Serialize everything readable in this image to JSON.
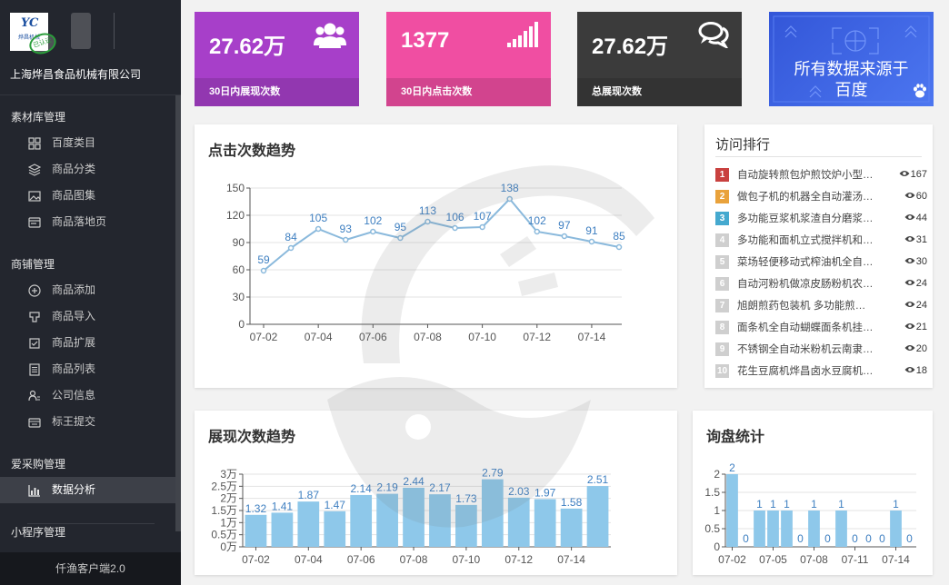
{
  "sidebar": {
    "logo_text": "YC",
    "logo_sub": "烨昌机械",
    "stamp_text": "已认证",
    "company": "上海烨昌食品机械有限公司",
    "groups": [
      {
        "title": "素材库管理",
        "items": [
          {
            "label": "百度类目",
            "icon": "grid-icon"
          },
          {
            "label": "商品分类",
            "icon": "layers-icon"
          },
          {
            "label": "商品图集",
            "icon": "image-icon"
          },
          {
            "label": "商品落地页",
            "icon": "browser-icon"
          }
        ]
      },
      {
        "title": "商铺管理",
        "items": [
          {
            "label": "商品添加",
            "icon": "plus-circle-icon"
          },
          {
            "label": "商品导入",
            "icon": "import-icon"
          },
          {
            "label": "商品扩展",
            "icon": "checklist-icon"
          },
          {
            "label": "商品列表",
            "icon": "list-icon"
          },
          {
            "label": "公司信息",
            "icon": "user-info-icon"
          },
          {
            "label": "标王提交",
            "icon": "store-icon"
          }
        ]
      },
      {
        "title": "爱采购管理",
        "items": [
          {
            "label": "数据分析",
            "icon": "bar-chart-icon",
            "active": true
          }
        ]
      },
      {
        "title": "小程序管理",
        "items": []
      }
    ],
    "footer": "仟渔客户端2.0"
  },
  "stats": [
    {
      "value": "27.62万",
      "label": "30日内展现次数",
      "icon": "users-icon",
      "color": "#a73fc9"
    },
    {
      "value": "1377",
      "label": "30日内点击次数",
      "icon": "signal-icon",
      "color": "#f04ea2"
    },
    {
      "value": "27.62万",
      "label": "总展现次数",
      "icon": "chat-icon",
      "color": "#3b3b3b"
    }
  ],
  "source_banner": {
    "line1": "所有数据来源于",
    "line2": "百度",
    "icon": "baidu-paw-icon"
  },
  "click_panel": {
    "title": "点击次数趋势"
  },
  "show_panel": {
    "title": "展现次数趋势"
  },
  "inquiry_panel": {
    "title": "询盘统计"
  },
  "rank_panel": {
    "title": "访问排行",
    "items": [
      {
        "no": "1",
        "name": "自动旋转煎包炉煎饺炉小型…",
        "views": "167",
        "color": "#c9413f"
      },
      {
        "no": "2",
        "name": "做包子机的机器全自动灌汤…",
        "views": "60",
        "color": "#e9a23b"
      },
      {
        "no": "3",
        "name": "多功能豆浆机浆渣自分磨浆…",
        "views": "44",
        "color": "#45a9cf"
      },
      {
        "no": "4",
        "name": "多功能和面机立式搅拌机和…",
        "views": "31",
        "color": "#cfcfcf"
      },
      {
        "no": "5",
        "name": "菜场轻便移动式榨油机全自…",
        "views": "30",
        "color": "#cfcfcf"
      },
      {
        "no": "6",
        "name": "自动河粉机做凉皮肠粉机农…",
        "views": "24",
        "color": "#cfcfcf"
      },
      {
        "no": "7",
        "name": "旭朗煎药包装机 多功能煎…",
        "views": "24",
        "color": "#cfcfcf"
      },
      {
        "no": "8",
        "name": "面条机全自动蝴蝶面条机挂…",
        "views": "21",
        "color": "#cfcfcf"
      },
      {
        "no": "9",
        "name": "不锈钢全自动米粉机云南隶…",
        "views": "20",
        "color": "#cfcfcf"
      },
      {
        "no": "10",
        "name": "花生豆腐机烨昌卤水豆腐机…",
        "views": "18",
        "color": "#cfcfcf"
      }
    ]
  },
  "chart_data": [
    {
      "type": "line",
      "title": "点击次数趋势",
      "x": [
        "07-02",
        "07-03",
        "07-04",
        "07-05",
        "07-06",
        "07-07",
        "07-08",
        "07-09",
        "07-10",
        "07-11",
        "07-12",
        "07-13",
        "07-14",
        "07-15"
      ],
      "x_tick_labels": [
        "07-02",
        "07-04",
        "07-06",
        "07-08",
        "07-10",
        "07-12",
        "07-14"
      ],
      "values": [
        59,
        84,
        105,
        93,
        102,
        95,
        113,
        106,
        107,
        138,
        102,
        97,
        91,
        85
      ],
      "ylim": [
        0,
        150
      ],
      "yticks": [
        "0",
        "30",
        "60",
        "90",
        "120",
        "150"
      ],
      "grid": true,
      "color": "#8ab9dc"
    },
    {
      "type": "bar",
      "title": "展现次数趋势",
      "x": [
        "07-02",
        "07-03",
        "07-04",
        "07-05",
        "07-06",
        "07-07",
        "07-08",
        "07-09",
        "07-10",
        "07-11",
        "07-12",
        "07-13",
        "07-14",
        "07-15"
      ],
      "x_tick_labels": [
        "07-02",
        "07-04",
        "07-06",
        "07-08",
        "07-10",
        "07-12",
        "07-14"
      ],
      "values": [
        1.32,
        1.41,
        1.87,
        1.47,
        2.14,
        2.19,
        2.44,
        2.17,
        1.73,
        2.79,
        2.03,
        1.97,
        1.58,
        2.51
      ],
      "unit": "万",
      "ylim": [
        0,
        3
      ],
      "yticks": [
        "0万",
        "0.5万",
        "1万",
        "1.5万",
        "2万",
        "2.5万",
        "3万"
      ],
      "grid": true,
      "color": "#8ec8ea"
    },
    {
      "type": "bar",
      "title": "询盘统计",
      "x": [
        "07-02",
        "07-03",
        "07-04",
        "07-05",
        "07-06",
        "07-07",
        "07-08",
        "07-09",
        "07-10",
        "07-11",
        "07-12",
        "07-13",
        "07-14",
        "07-15"
      ],
      "x_tick_labels": [
        "07-02",
        "07-05",
        "07-08",
        "07-11",
        "07-14"
      ],
      "values": [
        2,
        0,
        1,
        1,
        1,
        0,
        1,
        0,
        1,
        0,
        0,
        0,
        1,
        0
      ],
      "ylim": [
        0,
        2
      ],
      "yticks": [
        "0",
        "0.5",
        "1",
        "1.5",
        "2"
      ],
      "grid": true,
      "color": "#8ec8ea"
    }
  ]
}
